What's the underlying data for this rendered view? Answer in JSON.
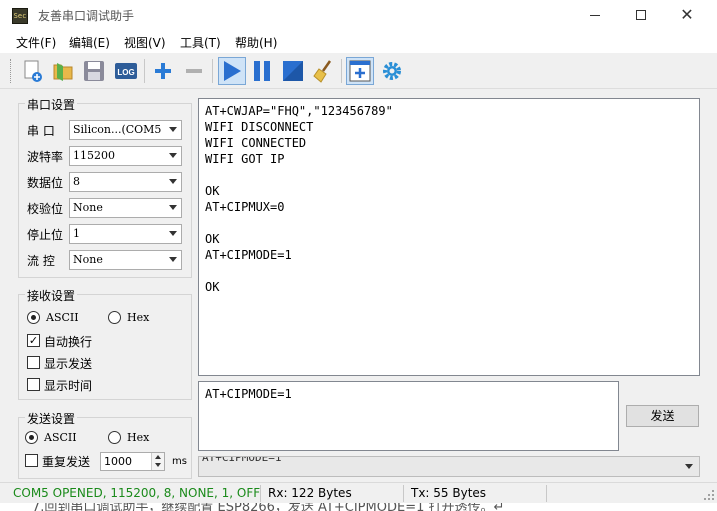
{
  "window": {
    "title": "友善串口调试助手",
    "icon_text": "Sec"
  },
  "menu": [
    "文件(F)",
    "编辑(E)",
    "视图(V)",
    "工具(T)",
    "帮助(H)"
  ],
  "toolbar": {
    "log_label": "LOG",
    "icons": [
      "new-file-icon",
      "open-folder-icon",
      "save-icon",
      "log-icon",
      "add-icon",
      "remove-icon",
      "play-icon",
      "pause-icon",
      "stop-icon",
      "clear-broom-icon",
      "add-window-icon",
      "gear-icon"
    ]
  },
  "serial": {
    "title": "串口设置",
    "fields": [
      {
        "label": "串 口",
        "value": "Silicon...(COM5"
      },
      {
        "label": "波特率",
        "value": "115200"
      },
      {
        "label": "数据位",
        "value": "8"
      },
      {
        "label": "校验位",
        "value": "None"
      },
      {
        "label": "停止位",
        "value": "1"
      },
      {
        "label": "流 控",
        "value": "None"
      }
    ]
  },
  "receive": {
    "title": "接收设置",
    "ascii": "ASCII",
    "hex": "Hex",
    "mode": "ascii",
    "auto_wrap": {
      "label": "自动换行",
      "checked": true
    },
    "show_send": {
      "label": "显示发送",
      "checked": false
    },
    "show_time": {
      "label": "显示时间",
      "checked": false
    }
  },
  "send": {
    "title": "发送设置",
    "ascii": "ASCII",
    "hex": "Hex",
    "mode": "ascii",
    "repeat": {
      "label": "重复发送",
      "checked": false
    },
    "interval": "1000",
    "unit": "ms",
    "button": "发送"
  },
  "receive_text": "AT+CWJAP=\"FHQ\",\"123456789\"\nWIFI DISCONNECT\nWIFI CONNECTED\nWIFI GOT IP\n\nOK\nAT+CIPMUX=0\n\nOK\nAT+CIPMODE=1\n\nOK",
  "send_text": "AT+CIPMODE=1",
  "history_value": "AT+CIPMODE=1",
  "status": {
    "port": "COM5 OPENED, 115200, 8, NONE, 1, OFF",
    "rx": "Rx: 122 Bytes",
    "tx": "Tx: 55 Bytes",
    "port_color": "#1a8a1a"
  },
  "background_doc_text": "7.回到串口调试助手，继续配置 ESP8266，发送 AT+CIPMODE=1 打开透传。↵"
}
